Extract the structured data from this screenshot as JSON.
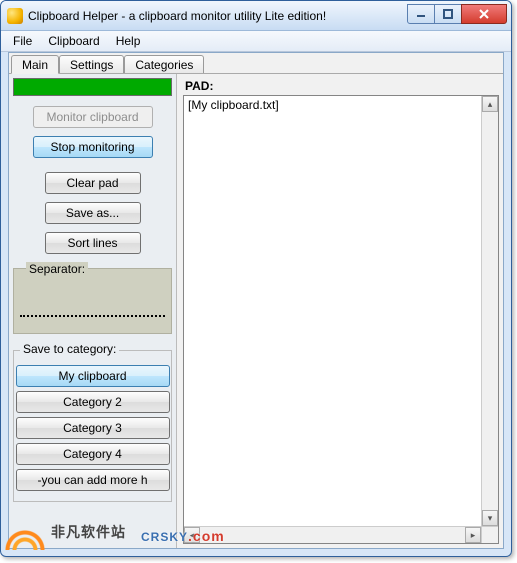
{
  "window": {
    "title": "Clipboard Helper - a clipboard monitor utility   Lite edition!"
  },
  "menu": {
    "items": [
      "File",
      "Clipboard",
      "Help"
    ]
  },
  "tabs": {
    "items": [
      "Main",
      "Settings",
      "Categories"
    ],
    "active": 0
  },
  "left": {
    "progress_percent": 100,
    "monitor_label": "Monitor clipboard",
    "stop_label": "Stop monitoring",
    "clear_label": "Clear pad",
    "saveas_label": "Save as...",
    "sort_label": "Sort lines",
    "separator_group_label": "Separator:",
    "save_to_label": "Save to category:",
    "categories": [
      "My clipboard",
      "Category 2",
      "Category 3",
      "Category 4",
      "-you can add more h"
    ]
  },
  "pad": {
    "label": "PAD:",
    "content": "[My clipboard.txt]"
  },
  "watermark": {
    "cn_text": "非凡软件站",
    "en_text": "CRSKY",
    "suffix": ".com"
  }
}
